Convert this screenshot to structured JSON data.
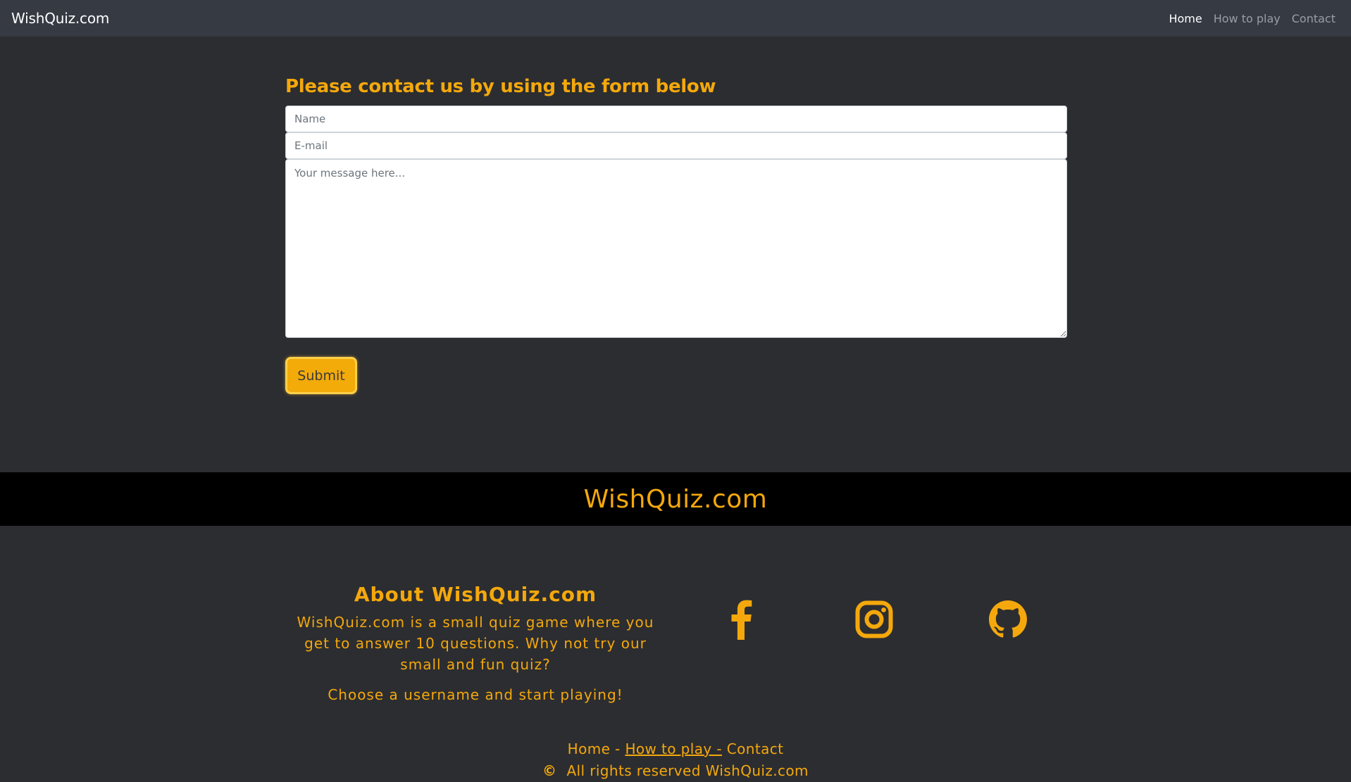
{
  "navbar": {
    "brand": "WishQuiz.com",
    "links": [
      {
        "label": "Home",
        "active": true
      },
      {
        "label": "How to play",
        "active": false
      },
      {
        "label": "Contact",
        "active": false
      }
    ]
  },
  "contact_form": {
    "title": "Please contact us by using the form below",
    "name_placeholder": "Name",
    "email_placeholder": "E-mail",
    "message_placeholder": "Your message here...",
    "submit_label": "Submit"
  },
  "footer": {
    "band_title": "WishQuiz.com",
    "about_heading": "About WishQuiz.com",
    "about_text": "WishQuiz.com is a small quiz game where you get to answer 10 questions. Why not try our small and fun quiz?",
    "about_cta": "Choose a username and start playing!",
    "social_icons": [
      "facebook-icon",
      "instagram-icon",
      "github-icon"
    ],
    "links": {
      "home": "Home -",
      "how_to_play": "How to play -",
      "contact": "Contact"
    },
    "copyright_symbol": "©",
    "copyright_text": "All rights reserved WishQuiz.com"
  },
  "colors": {
    "accent": "#f4a80c",
    "navbar_bg": "#353a43",
    "page_bg": "#2c2d30",
    "footer_band_bg": "#000000"
  }
}
